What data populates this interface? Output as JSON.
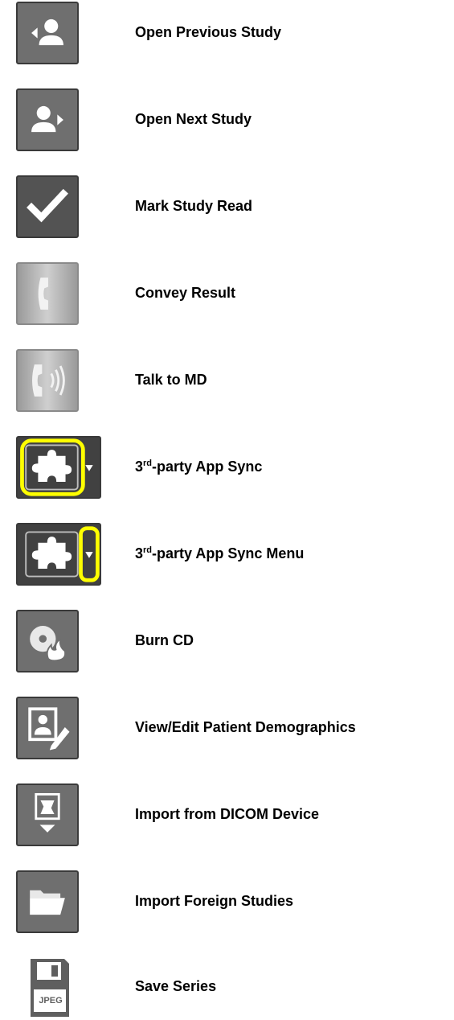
{
  "items": [
    {
      "id": "open-previous-study",
      "icon": "open-previous-study-icon",
      "label": "Open Previous Study"
    },
    {
      "id": "open-next-study",
      "icon": "open-next-study-icon",
      "label": "Open Next Study"
    },
    {
      "id": "mark-study-read",
      "icon": "checkmark-icon",
      "label": "Mark Study Read"
    },
    {
      "id": "convey-result",
      "icon": "phone-icon",
      "label": "Convey Result"
    },
    {
      "id": "talk-to-md",
      "icon": "phone-sound-icon",
      "label": "Talk to MD"
    },
    {
      "id": "third-party-app-sync",
      "icon": "puzzle-icon",
      "label_num": "3",
      "label_sup": "rd",
      "label_rest": "-party App Sync"
    },
    {
      "id": "third-party-app-sync-menu",
      "icon": "puzzle-dropdown-icon",
      "label_num": "3",
      "label_sup": "rd",
      "label_rest": "-party App Sync Menu"
    },
    {
      "id": "burn-cd",
      "icon": "cd-burn-icon",
      "label": "Burn CD"
    },
    {
      "id": "view-edit-patient-demographics",
      "icon": "patient-edit-icon",
      "label": "View/Edit Patient Demographics"
    },
    {
      "id": "import-from-dicom-device",
      "icon": "dicom-import-icon",
      "label": "Import from DICOM Device"
    },
    {
      "id": "import-foreign-studies",
      "icon": "folder-open-icon",
      "label": "Import Foreign Studies"
    },
    {
      "id": "save-series",
      "icon": "jpeg-floppy-icon",
      "icon_text": "JPEG",
      "label": "Save Series"
    }
  ],
  "colors": {
    "highlight": "#ffff00",
    "icon_bg": "#6f6f6f",
    "glyph": "#ffffff"
  }
}
